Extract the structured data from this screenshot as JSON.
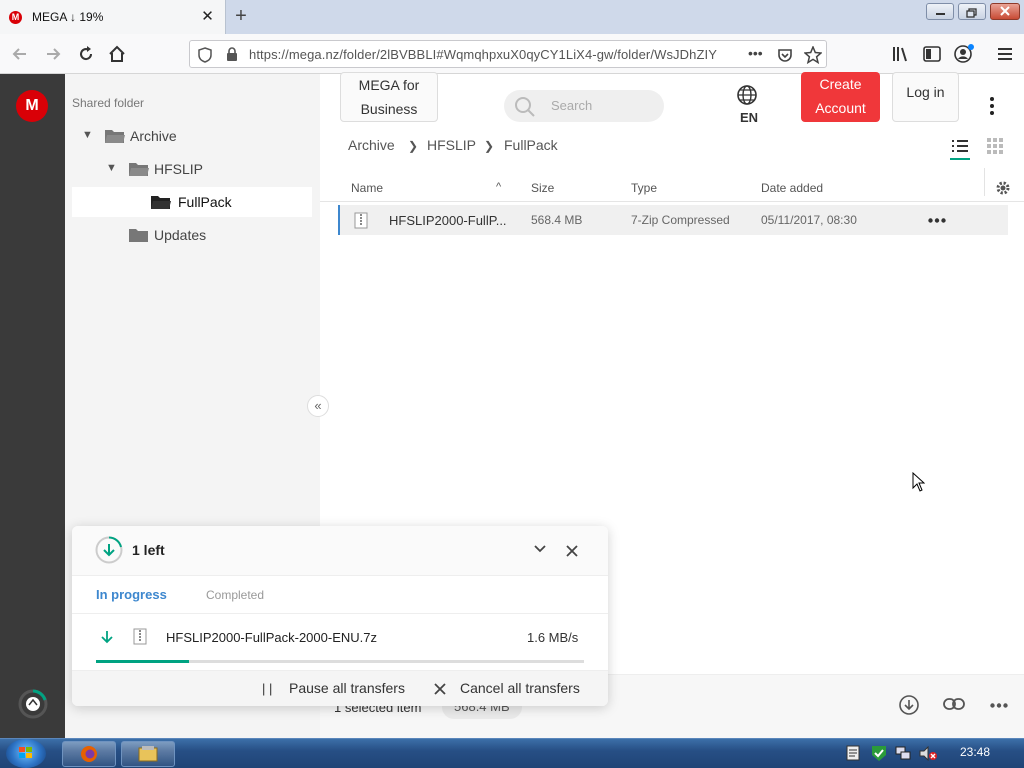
{
  "browser": {
    "tab_title": "MEGA ↓ 19%",
    "tab_favicon": "M",
    "url": "https://mega.nz/folder/2lBVBBLI#WqmqhpxuX0qyCY1LiX4-gw/folder/WsJDhZIY",
    "more": "•••"
  },
  "mega": {
    "logo": "M",
    "shared_folder_label": "Shared folder",
    "tree": [
      {
        "label": "Archive"
      },
      {
        "label": "HFSLIP"
      },
      {
        "label": "FullPack"
      },
      {
        "label": "Updates"
      }
    ],
    "header": {
      "business_line1": "MEGA for",
      "business_line2": "Business",
      "search_placeholder": "Search",
      "lang": "EN",
      "create_line1": "Create",
      "create_line2": "Account",
      "login": "Log in"
    },
    "breadcrumb": [
      "Archive",
      "HFSLIP",
      "FullPack"
    ],
    "table": {
      "columns": [
        "Name",
        "Size",
        "Type",
        "Date added"
      ],
      "rows": [
        {
          "name": "HFSLIP2000-FullP...",
          "size": "568.4 MB",
          "type": "7-Zip Compressed",
          "date": "05/11/2017, 08:30"
        }
      ]
    },
    "bottom": {
      "selected": "1 selected item",
      "selected_size": "568.4 MB"
    },
    "transfers": {
      "count": "1 left",
      "tab_active": "In progress",
      "tab_other": "Completed",
      "item_name": "HFSLIP2000-FullPack-2000-ENU.7z",
      "item_speed": "1.6 MB/s",
      "item_progress": 0.19,
      "pause_label": "Pause all transfers",
      "cancel_label": "Cancel all transfers"
    },
    "colors": {
      "brand": "#d90007",
      "create": "#f0373a",
      "accent": "#00a382",
      "link": "#3d87ce"
    }
  },
  "taskbar": {
    "clock": "23:48"
  }
}
